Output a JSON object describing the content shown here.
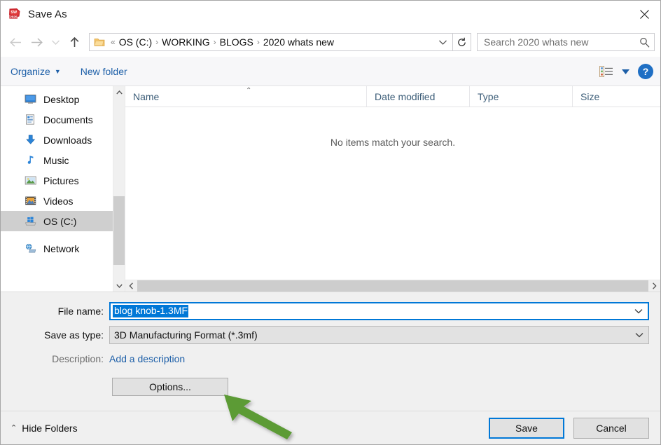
{
  "window": {
    "title": "Save As",
    "app_icon": "solidworks-2020-icon",
    "close_label": "✕"
  },
  "nav": {
    "back_icon": "arrow-left-icon",
    "forward_icon": "arrow-right-icon",
    "recent_icon": "chevron-down-icon",
    "up_icon": "arrow-up-icon",
    "address": {
      "folder_icon": "folder-icon",
      "prefix": "«",
      "crumbs": [
        "OS (C:)",
        "WORKING",
        "BLOGS",
        "2020 whats new"
      ],
      "separator": "›",
      "dropdown_icon": "chevron-down-icon"
    },
    "refresh_icon": "refresh-icon",
    "search": {
      "placeholder": "Search 2020 whats new",
      "icon": "search-icon"
    }
  },
  "commandbar": {
    "organize_label": "Organize",
    "organize_caret": "▼",
    "new_folder_label": "New folder",
    "view_icon": "list-view-icon",
    "view_caret": "▼",
    "help_label": "?"
  },
  "sidebar": {
    "items": [
      {
        "label": "Desktop",
        "icon": "desktop-icon",
        "selected": false
      },
      {
        "label": "Documents",
        "icon": "documents-icon",
        "selected": false
      },
      {
        "label": "Downloads",
        "icon": "downloads-icon",
        "selected": false
      },
      {
        "label": "Music",
        "icon": "music-icon",
        "selected": false
      },
      {
        "label": "Pictures",
        "icon": "pictures-icon",
        "selected": false
      },
      {
        "label": "Videos",
        "icon": "videos-icon",
        "selected": false
      },
      {
        "label": "OS (C:)",
        "icon": "drive-icon",
        "selected": true
      },
      {
        "label": "Network",
        "icon": "network-icon",
        "selected": false
      }
    ],
    "scroll_up_icon": "chevron-up-icon",
    "scroll_down_icon": "chevron-down-icon"
  },
  "filelist": {
    "columns": [
      {
        "label": "Name",
        "sorted": "asc",
        "sort_caret": "⌃"
      },
      {
        "label": "Date modified",
        "sorted": ""
      },
      {
        "label": "Type",
        "sorted": ""
      },
      {
        "label": "Size",
        "sorted": ""
      }
    ],
    "empty_message": "No items match your search.",
    "hscroll_left_icon": "chevron-left-icon",
    "hscroll_right_icon": "chevron-right-icon"
  },
  "form": {
    "filename_label": "File name:",
    "filename_value": "blog knob-1.3MF",
    "filename_selected": true,
    "filetype_label": "Save as type:",
    "filetype_value": "3D Manufacturing Format (*.3mf)",
    "description_label": "Description:",
    "description_link": "Add a description",
    "options_label": "Options...",
    "combo_caret_icon": "chevron-down-icon"
  },
  "footer": {
    "hide_folders_label": "Hide Folders",
    "hide_folders_caret": "⌃",
    "save_label": "Save",
    "cancel_label": "Cancel"
  },
  "annotation": {
    "type": "arrow",
    "color": "#5b9b34",
    "points_to": "options-button"
  },
  "colors": {
    "accent": "#0078d7",
    "link": "#1d5fa8",
    "selection": "#0078d7",
    "annotation_green": "#5b9b34",
    "form_background": "#f0f0f0"
  }
}
